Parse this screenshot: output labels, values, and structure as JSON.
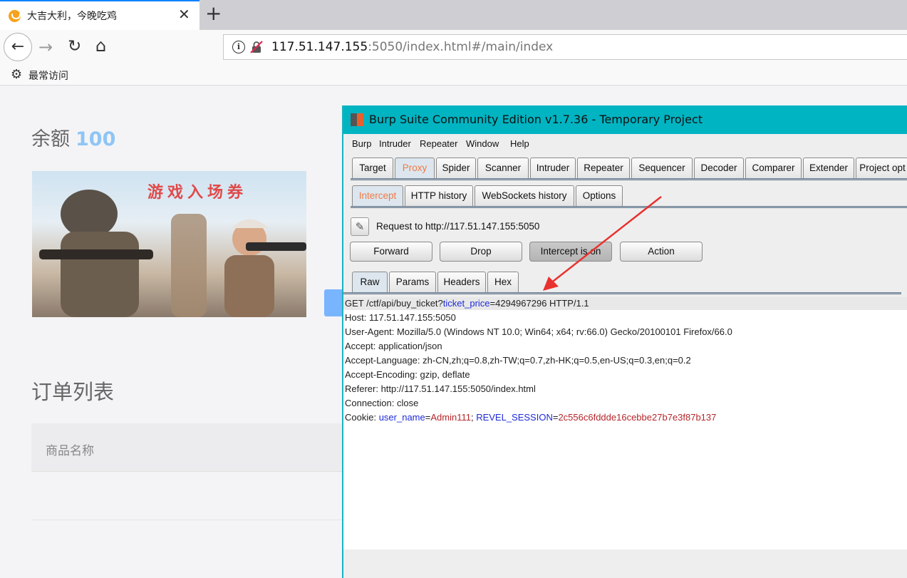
{
  "browser": {
    "tab_title": "大吉大利，今晚吃鸡",
    "tab_close": "✕",
    "new_tab": "+",
    "url_host": "117.51.147.155",
    "url_rest": ":5050/index.html#/main/index",
    "bookmark_label": "最常访问"
  },
  "page": {
    "balance_label": "余额",
    "balance_value": "100",
    "banner_text": "游戏入场券",
    "orders_title": "订单列表",
    "orders_column": "商品名称"
  },
  "burp": {
    "title": "Burp Suite Community Edition v1.7.36 - Temporary Project",
    "menu": [
      "Burp",
      "Intruder",
      "Repeater",
      "Window",
      "Help"
    ],
    "main_tabs": [
      "Target",
      "Proxy",
      "Spider",
      "Scanner",
      "Intruder",
      "Repeater",
      "Sequencer",
      "Decoder",
      "Comparer",
      "Extender",
      "Project opt"
    ],
    "proxy_tabs": [
      "Intercept",
      "HTTP history",
      "WebSockets history",
      "Options"
    ],
    "request_label": "Request to http://117.51.147.155:5050",
    "buttons": [
      "Forward",
      "Drop",
      "Intercept is on",
      "Action"
    ],
    "view_tabs": [
      "Raw",
      "Params",
      "Headers",
      "Hex"
    ],
    "request": {
      "line1_a": "GET /ctf/api/buy_ticket?",
      "line1_param": "ticket_price",
      "line1_b": "=4294967296 HTTP/1.1",
      "host": "Host: 117.51.147.155:5050",
      "user_agent": "User-Agent: Mozilla/5.0 (Windows NT 10.0; Win64; x64; rv:66.0) Gecko/20100101 Firefox/66.0",
      "accept": "Accept: application/json",
      "accept_language": "Accept-Language: zh-CN,zh;q=0.8,zh-TW;q=0.7,zh-HK;q=0.5,en-US;q=0.3,en;q=0.2",
      "accept_encoding": "Accept-Encoding: gzip, deflate",
      "referer": "Referer: http://117.51.147.155:5050/index.html",
      "connection": "Connection: close",
      "cookie_label": "Cookie: ",
      "cookie_name1": "user_name",
      "cookie_val1": "Admin111",
      "cookie_sep": "; ",
      "cookie_name2": "REVEL_SESSION",
      "cookie_val2": "2c556c6fddde16cebbe27b7e3f87b137"
    }
  },
  "colors": {
    "burp_title_bg": "#00b4c2",
    "active_tab_text": "#f07a45",
    "balance_value": "#8ec5f6",
    "arrow": "#e8322f"
  }
}
